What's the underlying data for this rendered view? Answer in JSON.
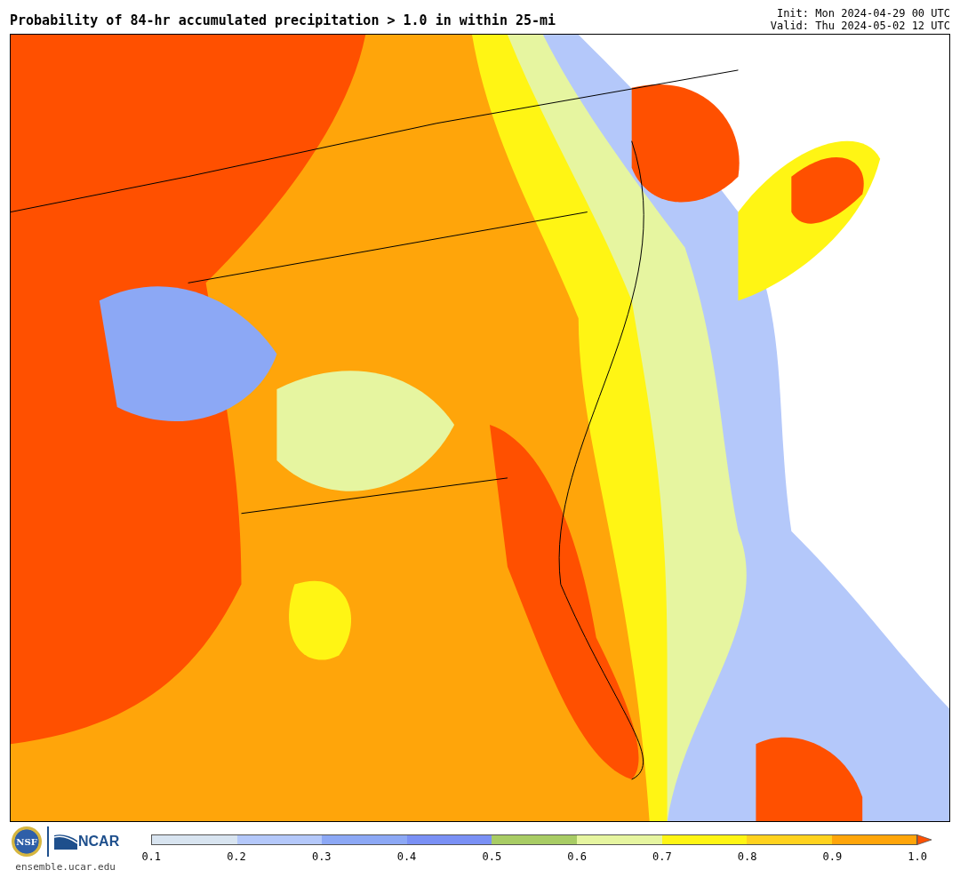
{
  "title": "Probability of 84-hr accumulated precipitation > 1.0 in within 25-mi",
  "init": "Init: Mon 2024-04-29 00 UTC",
  "valid": "Valid: Thu 2024-05-02 12 UTC",
  "logo": {
    "left": "NSF",
    "right": "NCAR",
    "url": "ensemble.ucar.edu"
  },
  "colorbar": {
    "bins": [
      {
        "color": "#d8e4f0"
      },
      {
        "color": "#b4c8fa"
      },
      {
        "color": "#8ca8f5"
      },
      {
        "color": "#7a90f5"
      },
      {
        "color": "#a8cc64"
      },
      {
        "color": "#e6f5a0"
      },
      {
        "color": "#fff514"
      },
      {
        "color": "#ffd21e"
      },
      {
        "color": "#ffa50a"
      }
    ],
    "overflow": {
      "color": "#ff5000"
    },
    "ticks": [
      "0.1",
      "0.2",
      "0.3",
      "0.4",
      "0.5",
      "0.6",
      "0.7",
      "0.8",
      "0.9",
      "1.0"
    ]
  }
}
